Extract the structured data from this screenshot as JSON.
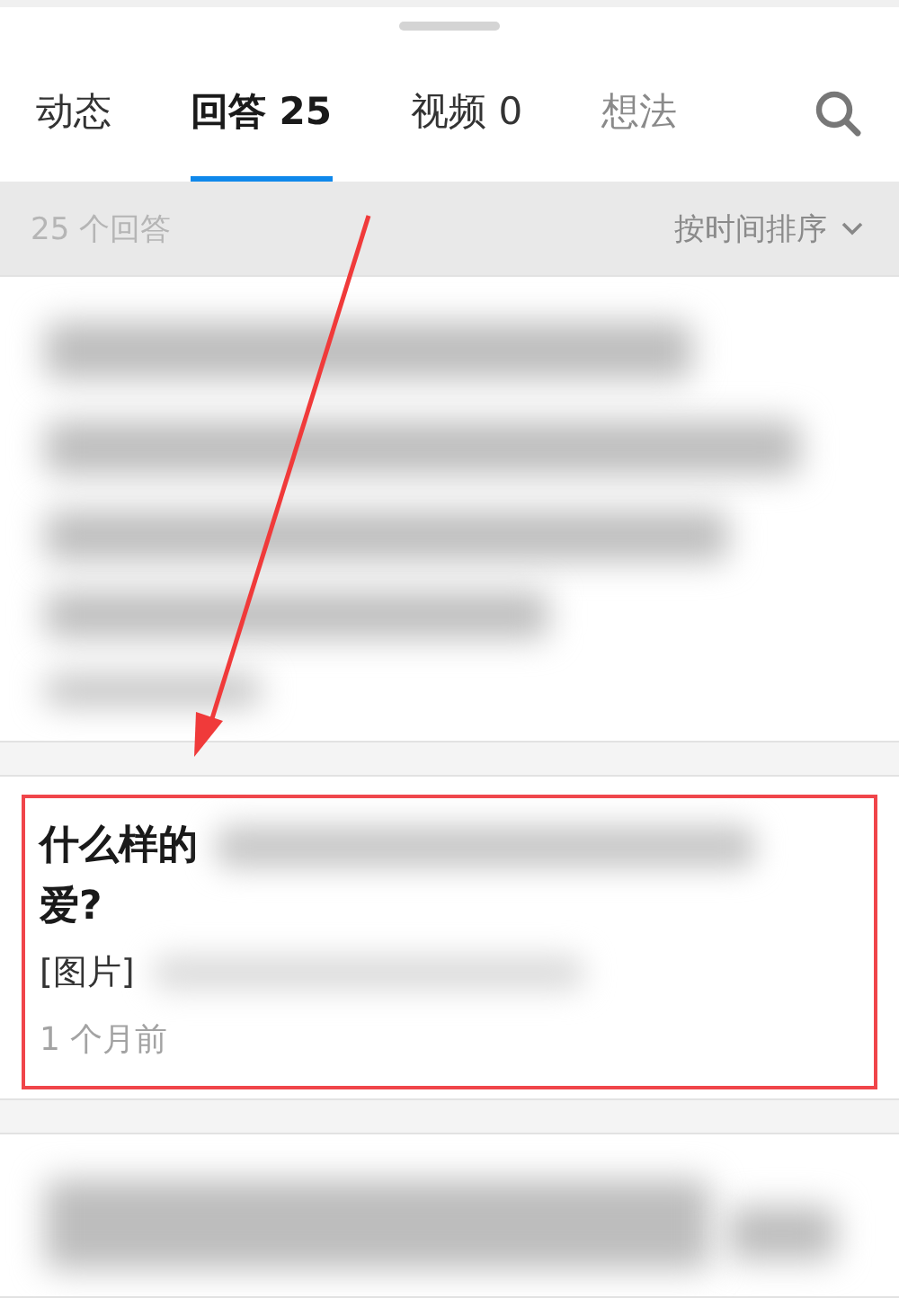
{
  "tabs": [
    {
      "label": "动态",
      "selected": false
    },
    {
      "label": "回答 25",
      "selected": true
    },
    {
      "label": "视频 0",
      "selected": false
    },
    {
      "label": "想法",
      "selected": false
    }
  ],
  "list_header": {
    "count": "25 个回答",
    "sort": "按时间排序"
  },
  "answers": [
    {
      "kind": "blurred"
    },
    {
      "kind": "answer",
      "highlighted": true,
      "title_line1": "什么样的",
      "title_line2": "爱?",
      "excerpt": "[图片]",
      "time": "1 个月前"
    },
    {
      "kind": "blurred"
    }
  ]
}
